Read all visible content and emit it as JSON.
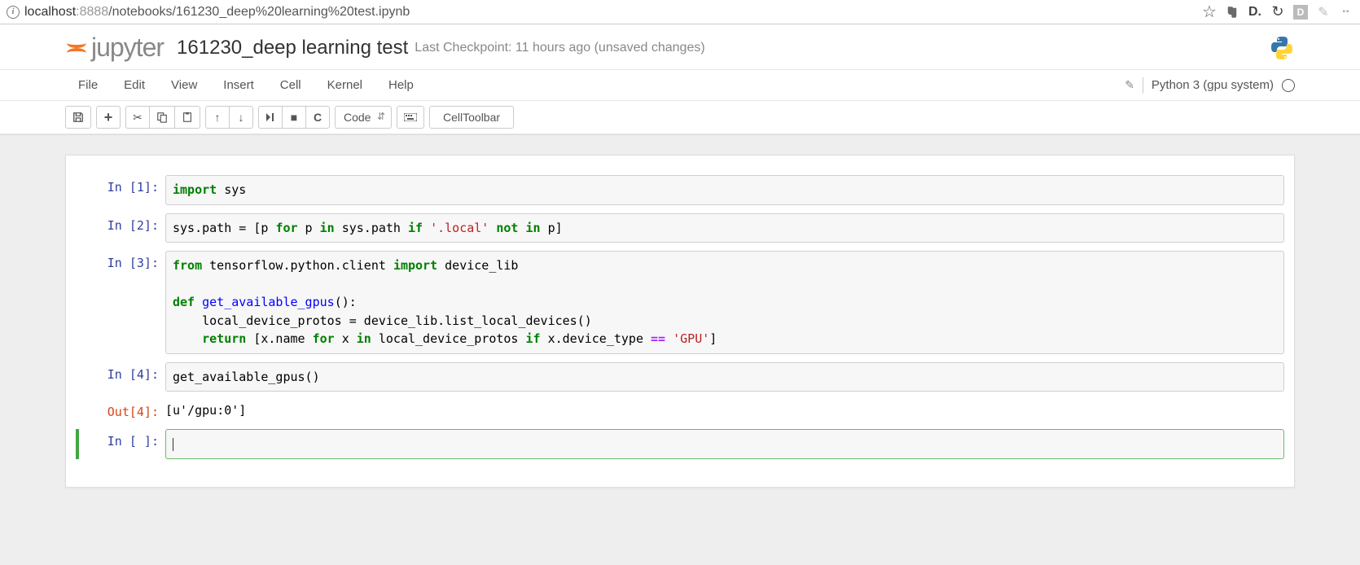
{
  "browser": {
    "url_host": "localhost",
    "url_port": ":8888",
    "url_path": "/notebooks/161230_deep%20learning%20test.ipynb"
  },
  "header": {
    "logo_text": "jupyter",
    "notebook_title": "161230_deep learning test",
    "checkpoint": "Last Checkpoint: 11 hours ago (unsaved changes)"
  },
  "menu": {
    "items": [
      "File",
      "Edit",
      "View",
      "Insert",
      "Cell",
      "Kernel",
      "Help"
    ],
    "kernel": "Python 3 (gpu system)"
  },
  "toolbar": {
    "celltype": "Code",
    "celltoolbar": "CellToolbar"
  },
  "cells": [
    {
      "in_prompt": "In [1]:",
      "code_plain": "import sys"
    },
    {
      "in_prompt": "In [2]:",
      "code_plain": "sys.path = [p for p in sys.path if '.local' not in p]"
    },
    {
      "in_prompt": "In [3]:",
      "code_plain": "from tensorflow.python.client import device_lib\n\ndef get_available_gpus():\n    local_device_protos = device_lib.list_local_devices()\n    return [x.name for x in local_device_protos if x.device_type == 'GPU']"
    },
    {
      "in_prompt": "In [4]:",
      "code_plain": "get_available_gpus()",
      "out_prompt": "Out[4]:",
      "out_text": "[u'/gpu:0']"
    },
    {
      "in_prompt": "In [ ]:",
      "code_plain": "",
      "selected": true
    }
  ]
}
